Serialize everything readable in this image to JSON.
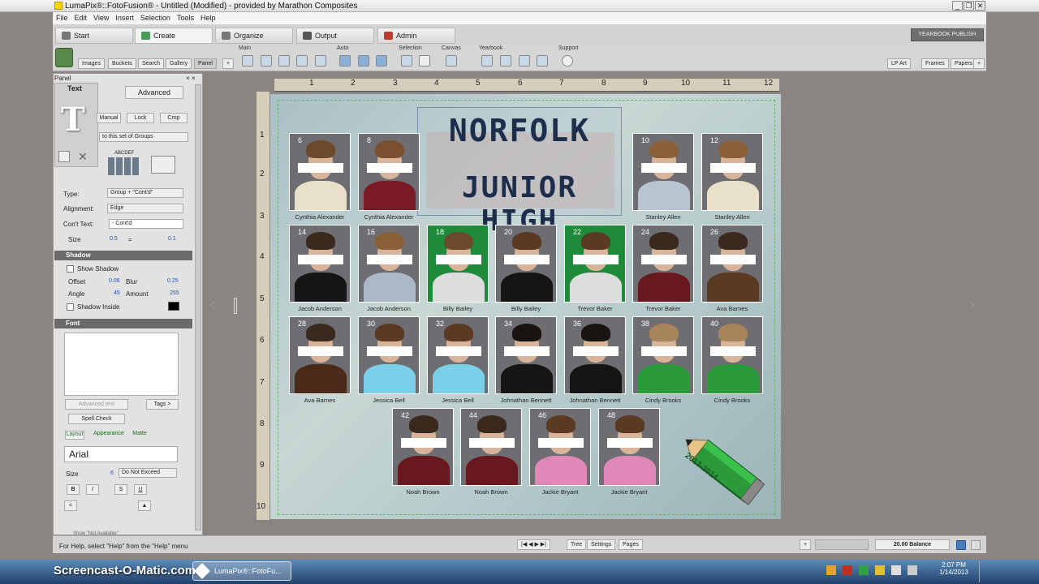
{
  "window": {
    "title": "LumaPix®::FotoFusion® - Untitled (Modified) - provided by Marathon Composites"
  },
  "menu": [
    "File",
    "Edit",
    "View",
    "Insert",
    "Selection",
    "Tools",
    "Help"
  ],
  "tabs": [
    {
      "label": "Start",
      "icon": "home-icon"
    },
    {
      "label": "Create",
      "icon": "create-icon"
    },
    {
      "label": "Organize",
      "icon": "list-icon"
    },
    {
      "label": "Output",
      "icon": "output-arrow-icon"
    },
    {
      "label": "Admin",
      "icon": "admin-user-icon"
    }
  ],
  "publish_label": "YEARBOOK PUBLISH",
  "toolbar": {
    "groups": [
      "Main",
      "Auto",
      "Selection",
      "Canvas",
      "Yearbook",
      "Support"
    ],
    "left_buttons": [
      "Images",
      "Buckets",
      "Search",
      "Gallery",
      "Panel"
    ],
    "right_buttons": [
      "LP Art",
      "Frames",
      "Papers"
    ]
  },
  "panel": {
    "title": "Panel",
    "tab_text": "Text",
    "advanced": "Advanced",
    "manual": "Manual",
    "lock": "Lock",
    "crop": "Crop",
    "group_scope": "to this set of Groups",
    "abcdef": "ABCDEF",
    "type_label": "Type:",
    "type_value": "Group + \"Cont'd\"",
    "alignment_label": "Alignment:",
    "alignment_value": "Edge",
    "contd_label": "Con't Text:",
    "contd_value": "- Cont'd",
    "size_label": "Size",
    "size_value": "0.5",
    "size_eq": "=",
    "size_value2": "0.1",
    "shadow_header": "Shadow",
    "show_shadow": "Show Shadow",
    "offset_label": "Offset",
    "offset_value": "0.06",
    "blur_label": "Blur",
    "blur_value": "0.25",
    "angle_label": "Angle",
    "angle_value": "45",
    "amount_label": "Amount",
    "amount_value": "255",
    "shadow_inside": "Shadow Inside",
    "font_header": "Font",
    "advanced_text": "Advanced text",
    "tags": "Tags >",
    "spell_check": "Spell Check",
    "subtabs": [
      "Layout",
      "Appearance",
      "Matte"
    ],
    "font_name": "Arial",
    "font_size_label": "Size",
    "font_size": "6",
    "do_not_exceed": "Do Not Exceed",
    "style_bold": "B",
    "style_italic": "I",
    "style_s": "S",
    "style_u": "U",
    "bottom_label": "Show \"Not Available\""
  },
  "ruler": {
    "h": [
      "1",
      "2",
      "3",
      "4",
      "5",
      "6",
      "7",
      "8",
      "9",
      "10",
      "11",
      "12"
    ],
    "v": [
      "1",
      "2",
      "3",
      "4",
      "5",
      "6",
      "7",
      "8",
      "9",
      "10"
    ]
  },
  "page_title": {
    "line1": "NORFOLK",
    "line2": "JUNIOR HIGH"
  },
  "photos": [
    {
      "num": "6",
      "name": "Cynthia Alexander",
      "shirt": "#e8e0c8",
      "hair": "#6a4a2a",
      "bg": "#6d6d72"
    },
    {
      "num": "8",
      "name": "Cynthia Alexander",
      "shirt": "#7a1a24",
      "hair": "#7a5030",
      "bg": "#6d6d72"
    },
    {
      "num": "10",
      "name": "Stanley Allen",
      "shirt": "#b8c4d0",
      "hair": "#8a6038",
      "bg": "#6d6d72"
    },
    {
      "num": "12",
      "name": "Stanley Allen",
      "shirt": "#e8e0c8",
      "hair": "#8a6038",
      "bg": "#6d6d72"
    },
    {
      "num": "14",
      "name": "Jacob Anderson",
      "shirt": "#151515",
      "hair": "#3a2a1e",
      "bg": "#6d6d72"
    },
    {
      "num": "16",
      "name": "Jacob Anderson",
      "shirt": "#aab8c8",
      "hair": "#8a6038",
      "bg": "#6d6d72"
    },
    {
      "num": "18",
      "name": "Billy Bailey",
      "shirt": "#ddd",
      "hair": "#6a4a2a",
      "bg": "#1f8a3a"
    },
    {
      "num": "20",
      "name": "Billy Bailey",
      "shirt": "#151515",
      "hair": "#5a3a22",
      "bg": "#6d6d72"
    },
    {
      "num": "22",
      "name": "Trevor Baker",
      "shirt": "#ddd",
      "hair": "#5a3a22",
      "bg": "#1f8a3a"
    },
    {
      "num": "24",
      "name": "Trevor Baker",
      "shirt": "#6a1820",
      "hair": "#3a2a1e",
      "bg": "#6d6d72"
    },
    {
      "num": "26",
      "name": "Ava Barnes",
      "shirt": "#5a3a22",
      "hair": "#3a2a1e",
      "bg": "#6d6d72"
    },
    {
      "num": "28",
      "name": "Ava Barnes",
      "shirt": "#4a2a18",
      "hair": "#3a2a1e",
      "bg": "#6d6d72"
    },
    {
      "num": "30",
      "name": "Jessica Bell",
      "shirt": "#7ad0e8",
      "hair": "#5a3a22",
      "bg": "#6d6d72"
    },
    {
      "num": "32",
      "name": "Jessica Bell",
      "shirt": "#7ad0e8",
      "hair": "#5a3a22",
      "bg": "#6d6d72"
    },
    {
      "num": "34",
      "name": "Johnathan Bennett",
      "shirt": "#151515",
      "hair": "#1a1410",
      "bg": "#6d6d72"
    },
    {
      "num": "36",
      "name": "Johnathan Bennett",
      "shirt": "#151515",
      "hair": "#1a1410",
      "bg": "#6d6d72"
    },
    {
      "num": "38",
      "name": "Cindy Brooks",
      "shirt": "#2a9a3a",
      "hair": "#a8845a",
      "bg": "#6d6d72"
    },
    {
      "num": "40",
      "name": "Cindy Brooks",
      "shirt": "#2a9a3a",
      "hair": "#a8845a",
      "bg": "#6d6d72"
    },
    {
      "num": "42",
      "name": "Noah Brown",
      "shirt": "#6a1820",
      "hair": "#3a2a1e",
      "bg": "#6d6d72"
    },
    {
      "num": "44",
      "name": "Noah Brown",
      "shirt": "#6a1820",
      "hair": "#3a2a1e",
      "bg": "#6d6d72"
    },
    {
      "num": "46",
      "name": "Jackie Bryant",
      "shirt": "#e088b8",
      "hair": "#5a3a22",
      "bg": "#6d6d72"
    },
    {
      "num": "48",
      "name": "Jackie Bryant",
      "shirt": "#e088b8",
      "hair": "#5a3a22",
      "bg": "#6d6d72"
    }
  ],
  "pencil_text": "2013-2014",
  "status": {
    "help": "For Help, select \"Help\" from the \"Help\" menu",
    "tree": "Tree",
    "settings": "Settings",
    "pages": "Pages",
    "balance": "20.00 Balance"
  },
  "taskbar": {
    "watermark": "Screencast-O-Matic.com",
    "app": "LumaPix®::FotoFu...",
    "time": "2:07 PM",
    "date": "1/14/2013"
  }
}
